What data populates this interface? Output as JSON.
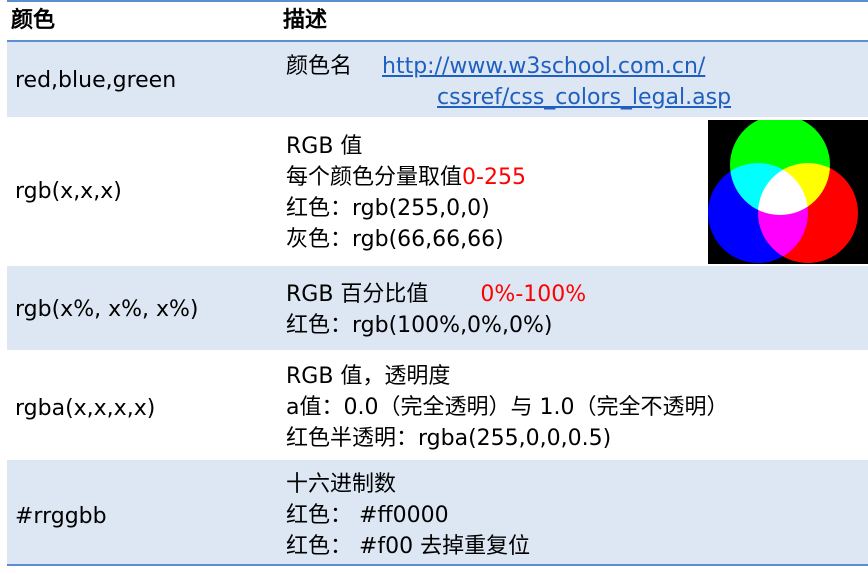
{
  "header": {
    "col1": "颜色",
    "col2": "描述"
  },
  "rows": [
    {
      "name": "red,blue,green",
      "desc": {
        "prefix": "颜色名",
        "link_line1": "http://www.w3school.com.cn/",
        "link_line2": "cssref/css_colors_legal.asp"
      }
    },
    {
      "name": "rgb(x,x,x)",
      "lines": [
        "RGB 值",
        "每个颜色分量取值",
        "红色：rgb(255,0,0)",
        "灰色：rgb(66,66,66)"
      ],
      "highlight": "0-255",
      "image_label": "rgb-venn"
    },
    {
      "name": "rgb(x%, x%, x%)",
      "lines": [
        "RGB 百分比值",
        "红色：rgb(100%,0%,0%)"
      ],
      "highlight": "0%-100%"
    },
    {
      "name": "rgba(x,x,x,x)",
      "lines": [
        "RGB 值，透明度",
        "a值：0.0（完全透明）与 1.0（完全不透明）",
        "红色半透明：rgba(255,0,0,0.5)"
      ]
    },
    {
      "name": "#rrggbb",
      "lines": [
        "十六进制数",
        "红色： #ff0000",
        "红色： #f00  去掉重复位"
      ]
    }
  ],
  "colors": {
    "row_alt": "#dde7f3",
    "rule": "#5b8fd0",
    "highlight": "#ff0000",
    "link": "#1f5fbf"
  }
}
